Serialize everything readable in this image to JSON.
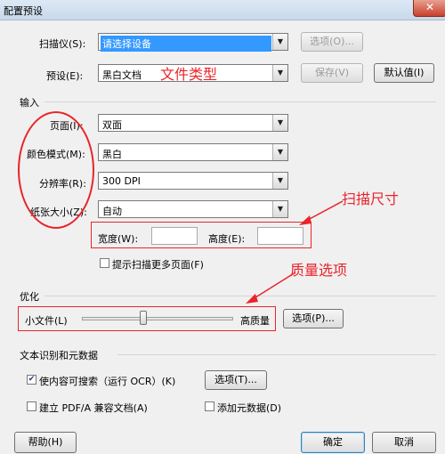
{
  "window": {
    "title": "配置预设",
    "close": "✕"
  },
  "scanner": {
    "label": "扫描仪(S):",
    "value": "请选择设备",
    "options_button": "选项(O)..."
  },
  "preset": {
    "label": "预设(E):",
    "value": "黑白文档",
    "save_button": "保存(V)",
    "default_button": "默认值(I)"
  },
  "input_group": {
    "title": "输入",
    "sides": {
      "label": "页面(I):",
      "value": "双面"
    },
    "color_mode": {
      "label": "颜色模式(M):",
      "value": "黑白"
    },
    "resolution": {
      "label": "分辨率(R):",
      "value": "300 DPI"
    },
    "paper_size": {
      "label": "纸张大小(Z):",
      "value": "自动"
    },
    "width_label": "宽度(W):",
    "height_label": "高度(E):",
    "prompt_more": {
      "label": "提示扫描更多页面(F)",
      "checked": false
    }
  },
  "optimize_group": {
    "title": "优化",
    "small_label": "小文件(L)",
    "high_label": "高质量",
    "quality_level": 0.4,
    "options_button": "选项(P)..."
  },
  "ocr_group": {
    "title": "文本识别和元数据",
    "searchable": {
      "label": "使内容可搜索（运行 OCR）(K)",
      "checked": true
    },
    "ocr_options_button": "选项(T)...",
    "pdfa": {
      "label": "建立 PDF/A 兼容文档(A)",
      "checked": false
    },
    "metadata": {
      "label": "添加元数据(D)",
      "checked": false
    }
  },
  "footer": {
    "help_button": "帮助(H)",
    "ok_button": "确定",
    "cancel_button": "取消"
  },
  "annotations": {
    "file_type": "文件类型",
    "scan_size": "扫描尺寸",
    "quality": "质量选项",
    "color": "#e8252a"
  }
}
